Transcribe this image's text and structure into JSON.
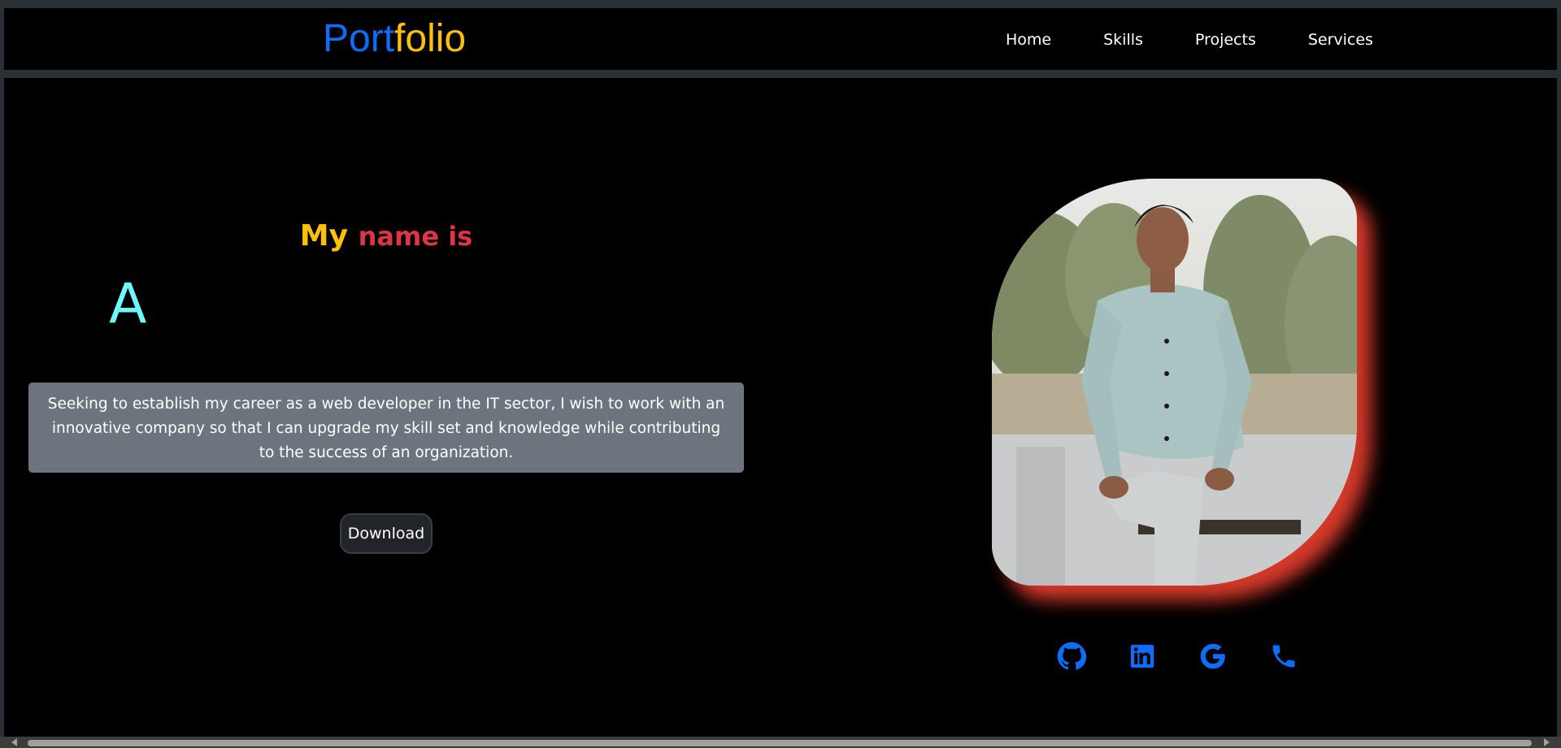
{
  "navbar": {
    "brand_part1": "Port",
    "brand_part2": "folio",
    "links": [
      "Home",
      "Skills",
      "Projects",
      "Services"
    ]
  },
  "hero": {
    "intro_word1": "My",
    "intro_word2": "name is",
    "typed_name": "A",
    "summary": "Seeking to establish my career as a web developer in the IT sector, I wish to work with an innovative company so that I can upgrade my skill set and knowledge while contributing to the success of an organization.",
    "download_label": "Download"
  },
  "social": [
    "github-icon",
    "linkedin-icon",
    "google-icon",
    "phone-icon"
  ],
  "colors": {
    "brand_blue": "#0d6efd",
    "brand_yellow": "#ffc107",
    "accent_red": "#dc3545",
    "typed_cyan": "#6ef7fc",
    "photo_glow": "#d6392a"
  }
}
